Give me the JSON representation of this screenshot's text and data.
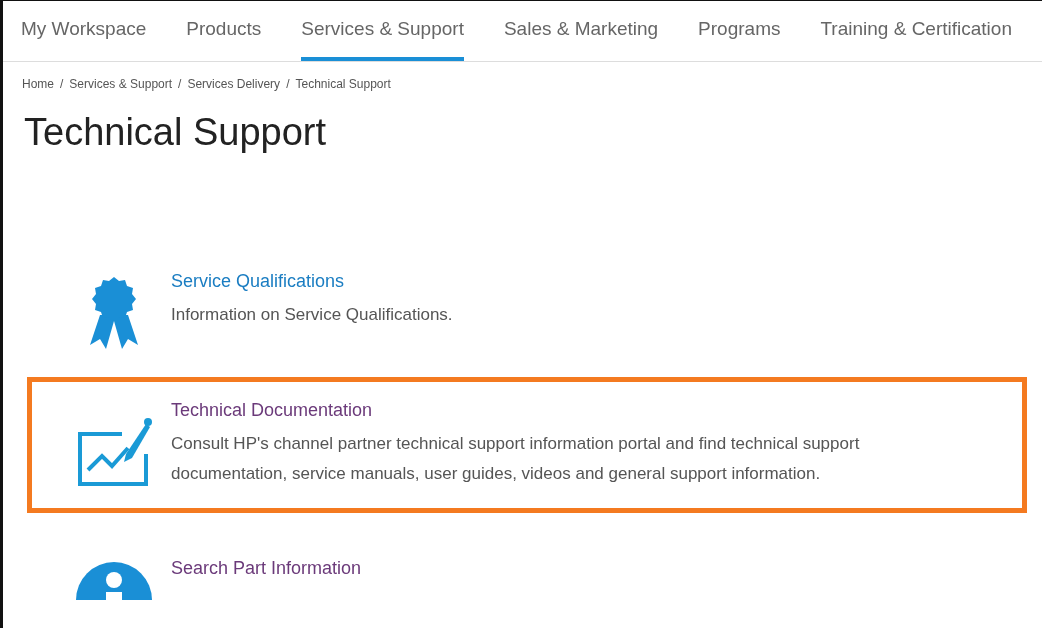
{
  "nav_tabs": [
    {
      "label": "My Workspace",
      "selected": false
    },
    {
      "label": "Products",
      "selected": false
    },
    {
      "label": "Services & Support",
      "selected": true
    },
    {
      "label": "Sales & Marketing",
      "selected": false
    },
    {
      "label": "Programs",
      "selected": false
    },
    {
      "label": "Training & Certification",
      "selected": false
    }
  ],
  "breadcrumb": [
    "Home",
    "Services & Support",
    "Services Delivery",
    "Technical Support"
  ],
  "breadcrumb_separator": "/",
  "page_title": "Technical Support",
  "services": [
    {
      "kind": "ribbon",
      "title": "Service Qualifications",
      "description": "Information on Service Qualifications.",
      "visited": false,
      "highlighted": false
    },
    {
      "kind": "chart",
      "title": "Technical Documentation",
      "description": "Consult HP's channel partner technical support information portal and find technical support documentation, service manuals, user guides, videos and general support information.",
      "visited": true,
      "highlighted": true
    },
    {
      "kind": "person",
      "title": "Search Part Information",
      "visited": true,
      "highlighted": false
    }
  ]
}
